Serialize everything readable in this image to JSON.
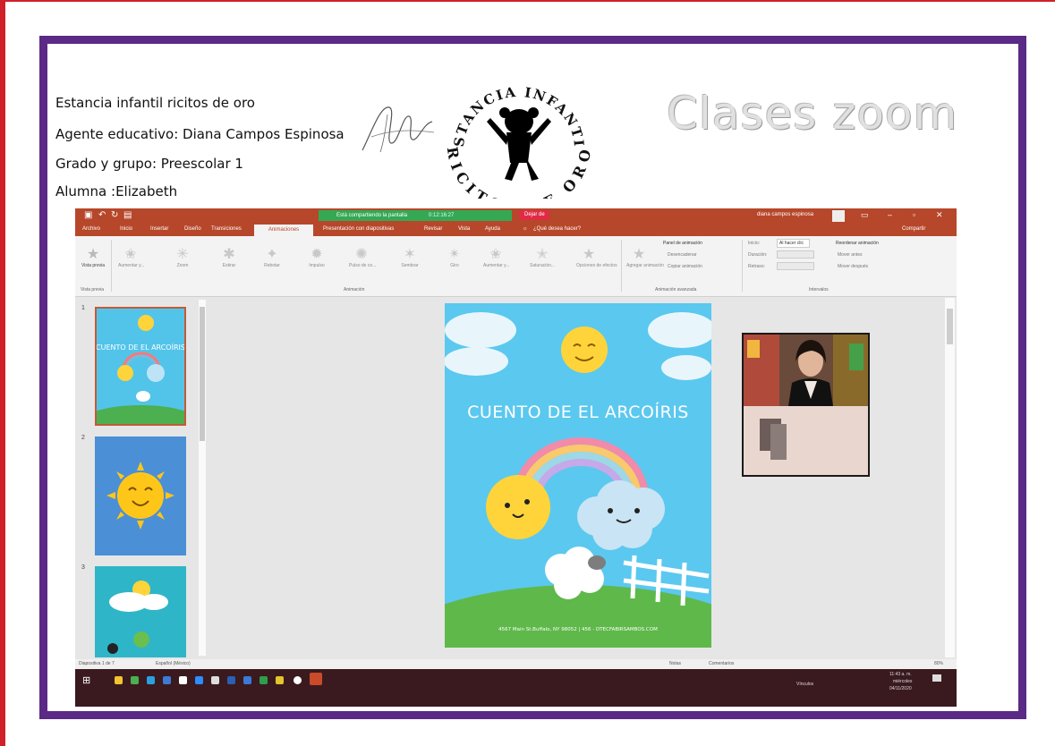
{
  "document": {
    "title": "Clases zoom",
    "lines": [
      "Estancia infantil ricitos de oro",
      "Agente educativo: Diana Campos Espinosa",
      "Grado y grupo: Preescolar 1",
      "Alumna :Elizabeth"
    ],
    "logo": {
      "top_text": "ESTANCIA INFANTIL",
      "bottom_text": "RICITOS DE ORO"
    }
  },
  "ppt": {
    "share_status": "Está compartiendo la pantalla",
    "share_time": "0:12:16:27",
    "stop_label": "Dejar de",
    "user": "diana campos espinosa",
    "menu": [
      "Archivo",
      "Inicio",
      "Insertar",
      "Diseño",
      "Transiciones",
      "Animaciones",
      "Presentación con diapositivas",
      "Revisar",
      "Vista",
      "Ayuda",
      "¿Qué desea hacer?"
    ],
    "share_label": "Compartir",
    "ribbon": {
      "preview": "Vista previa",
      "animations": [
        "Aumentar y...",
        "Zoom",
        "Estirar",
        "Rebotar",
        "Impulso",
        "Pulso de co...",
        "Sembrar",
        "Giro",
        "Aumentar y...",
        "Saturación..."
      ],
      "effect_options": "Opciones de efectos",
      "add_animation": "Agregar animación",
      "anim_panel": "Panel de animación",
      "trigger": "Desencadenar",
      "copy_anim": "Copiar animación",
      "start_label": "Inicio:",
      "start_value": "Al hacer clic",
      "duration": "Duración:",
      "delay": "Retraso:",
      "reorder": "Reordenar animación",
      "move_earlier": "Mover antes",
      "move_later": "Mover después",
      "groups": [
        "Vista previa",
        "Animación",
        "Animación avanzada",
        "Intervalos"
      ]
    },
    "thumbnails": [
      "1",
      "2",
      "3"
    ],
    "slide": {
      "title": "CUENTO DE EL ARCOÍRIS",
      "footer": "4567 Main St.Buffalo, NY 98052 | 456 - DTECFABIRSAMBOS.COM"
    },
    "thumb1_title": "CUENTO DE EL ARCOÍRIS",
    "status": {
      "slide": "Diapositiva 1 de 7",
      "lang": "Español (México)",
      "notes": "Notas",
      "comments": "Comentarios",
      "zoom": "80%"
    },
    "taskbar": {
      "vinculos": "Vínculos",
      "time": "11:43 a. m.",
      "day": "miércoles",
      "date": "04/11/2020"
    },
    "colors": {
      "accent": "#b7472a",
      "share": "#34a853",
      "frame": "#5a2a86",
      "border": "#d0202a"
    }
  }
}
